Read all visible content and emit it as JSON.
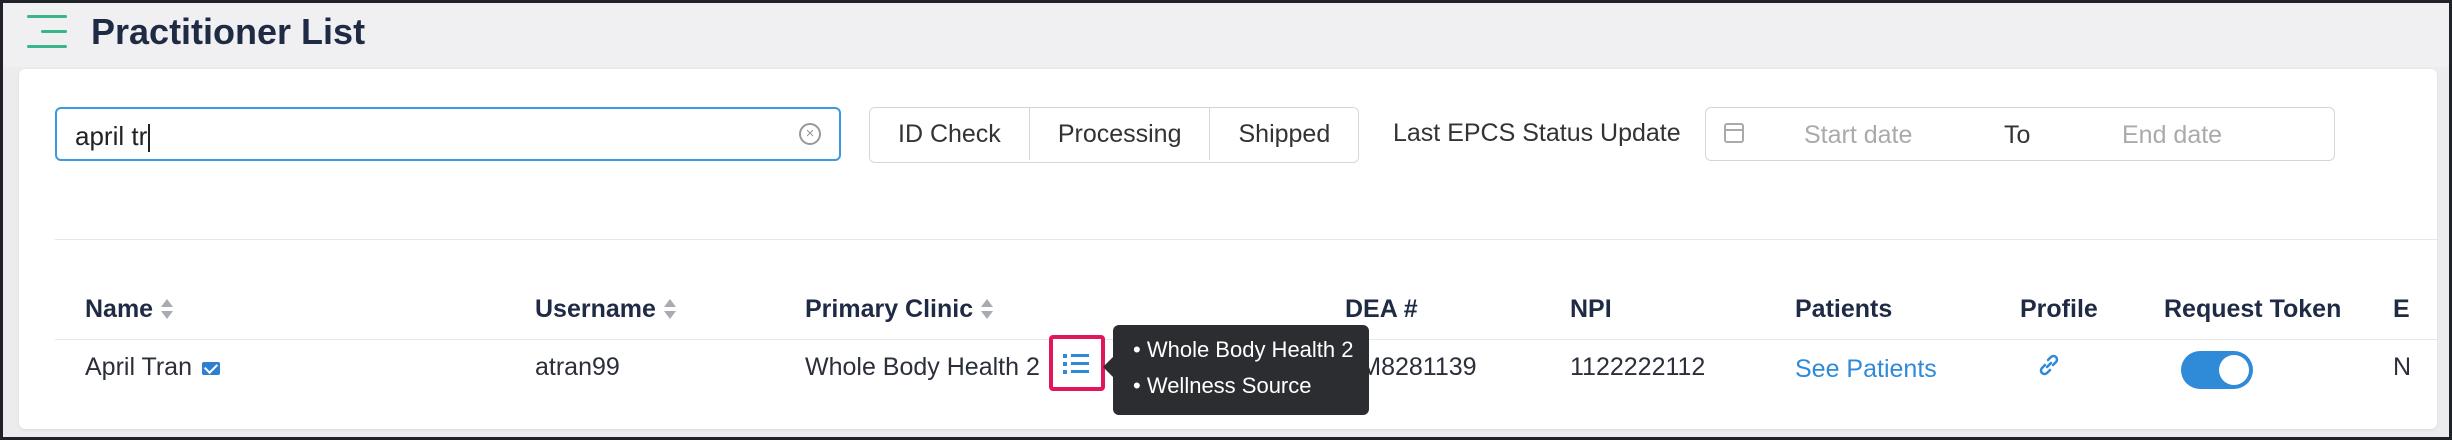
{
  "header": {
    "title": "Practitioner List"
  },
  "search": {
    "value": "april tr"
  },
  "filters": [
    "ID Check",
    "Processing",
    "Shipped"
  ],
  "epcs": {
    "label": "Last EPCS Status Update",
    "start_placeholder": "Start date",
    "to_label": "To",
    "end_placeholder": "End date"
  },
  "table": {
    "columns": [
      "Name",
      "Username",
      "Primary Clinic",
      "DEA #",
      "NPI",
      "Patients",
      "Profile",
      "Request Token",
      "E"
    ],
    "rows": [
      {
        "name": "April Tran",
        "username": "atran99",
        "primary_clinic": "Whole Body Health 2",
        "dea": "FM8281139",
        "npi": "1122222112",
        "patients": "See Patients",
        "request_token_enabled": true,
        "trailing": "N"
      }
    ]
  },
  "tooltip": {
    "items": [
      "Whole Body Health 2",
      "Wellness Source"
    ]
  },
  "colors": {
    "accent": "#2f8ad8",
    "highlight": "#e0175b",
    "menu": "#39b58a"
  }
}
